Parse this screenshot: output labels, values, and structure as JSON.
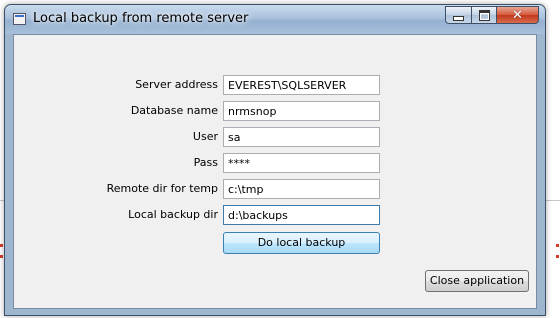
{
  "window": {
    "title": "Local backup from remote server"
  },
  "form": {
    "fields": [
      {
        "label": "Server address",
        "value": "EVEREST\\SQLSERVER"
      },
      {
        "label": "Database name",
        "value": "nrmsnop"
      },
      {
        "label": "User",
        "value": "sa"
      },
      {
        "label": "Pass",
        "value": "****"
      },
      {
        "label": "Remote dir for temp",
        "value": "c:\\tmp"
      },
      {
        "label": "Local backup dir",
        "value": "d:\\backups"
      }
    ]
  },
  "buttons": {
    "backup": "Do local backup",
    "close": "Close application"
  },
  "colors": {
    "titlebar": "#a9c1dc",
    "client": "#f0f0f0",
    "close_button": "#c2381a",
    "default_button": "#bee6fd"
  }
}
